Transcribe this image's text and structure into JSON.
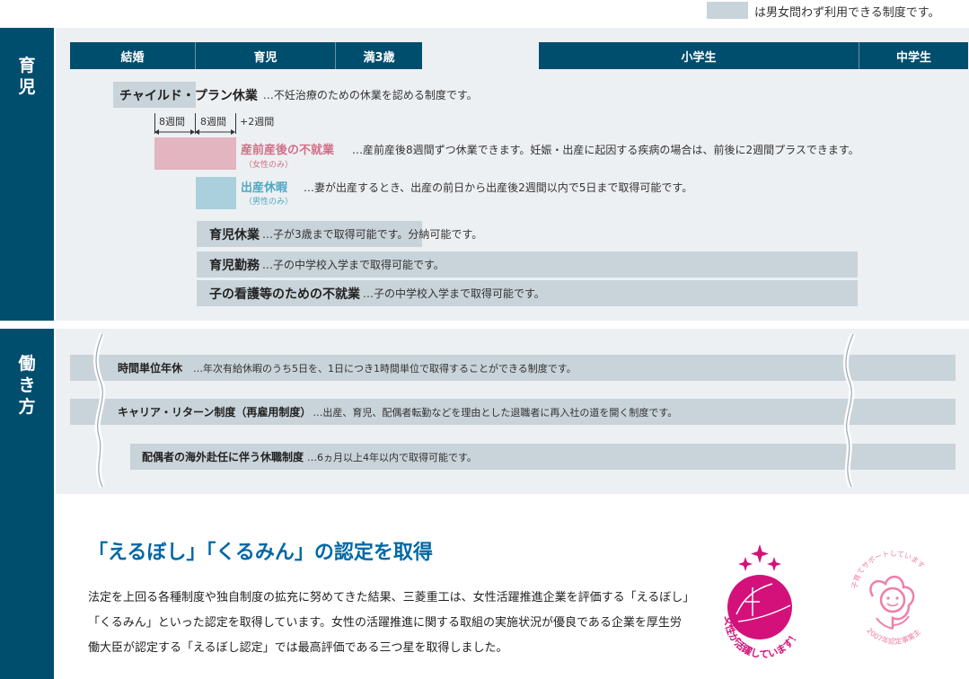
{
  "legend": {
    "text": "は男女問わず利用できる制度です。"
  },
  "sections": {
    "childcare": "育児",
    "working": "働き方"
  },
  "timeline": {
    "marriage": "結婚",
    "childcare": "育児",
    "age3": "満3歳",
    "elementary": "小学生",
    "junior_high": "中学生"
  },
  "childcare": {
    "child_plan": {
      "name": "チャイルド・プラン休業",
      "desc": "…不妊治療のための休業を認める制度です。"
    },
    "weeks": {
      "w1": "8週間",
      "w2": "8週間",
      "w3": "+2週間"
    },
    "maternity": {
      "name": "産前産後の不就業",
      "note": "（女性のみ）",
      "desc": "…産前産後8週間ずつ休業できます。妊娠・出産に起因する疾病の場合は、前後に2週間プラスできます。"
    },
    "paternity": {
      "name": "出産休暇",
      "note": "（男性のみ）",
      "desc": "…妻が出産するとき、出産の前日から出産後2週間以内で5日まで取得可能です。"
    },
    "leave": {
      "name": "育児休業",
      "desc": "…子が3歳まで取得可能です。分納可能です。"
    },
    "short_work": {
      "name": "育児勤務",
      "desc": "…子の中学校入学まで取得可能です。"
    },
    "nursing": {
      "name": "子の看護等のための不就業",
      "desc": "…子の中学校入学まで取得可能です。"
    }
  },
  "working": {
    "hourly": {
      "name": "時間単位年休",
      "desc": "…年次有給休暇のうち5日を、1日につき1時間単位で取得することができる制度です。"
    },
    "career_return": {
      "name": "キャリア・リターン制度（再雇用制度）",
      "desc": "…出産、育児、配偶者転勤などを理由とした退職者に再入社の道を開く制度です。"
    },
    "spouse_overseas": {
      "name": "配偶者の海外赴任に伴う休職制度",
      "desc": "…6ヵ月以上4年以内で取得可能です。"
    }
  },
  "certification": {
    "title": "「えるぼし」「くるみん」の認定を取得",
    "body": "法定を上回る各種制度や独自制度の拡充に努めてきた結果、三菱重工は、女性活躍推進企業を評価する「えるぼし」「くるみん」といった認定を取得しています。女性の活躍推進に関する取組の実施状況が優良である企業を厚生労働大臣が認定する「えるぼし認定」では最高評価である三つ星を取得しました。",
    "eruboshi_text": "女性が活躍しています！",
    "kurumin_arc": "子育てサポートしています",
    "kurumin_year": "2007年認定事業主"
  },
  "colors": {
    "navy": "#004e6e",
    "pink": "#e2b5c0",
    "light_blue": "#a9d0dc",
    "gray_bar": "#c9d3da",
    "title_blue": "#0068a6",
    "magenta": "#d4117a",
    "kurumin_pink": "#ef7fa8"
  }
}
